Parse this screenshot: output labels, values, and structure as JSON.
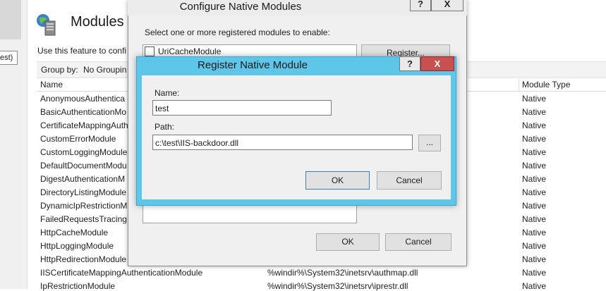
{
  "left_strip": {
    "selected_text": "est)"
  },
  "page": {
    "title": "Modules",
    "description": "Use this feature to confi",
    "group_by_label": "Group by:",
    "group_by_value": "No Groupin",
    "columns": {
      "name": "Name",
      "module_type": "Module Type"
    },
    "rows": [
      {
        "name": "AnonymousAuthentica",
        "code": "",
        "type": "Native"
      },
      {
        "name": "BasicAuthenticationMo",
        "code": "",
        "type": "Native"
      },
      {
        "name": "CertificateMappingAuth",
        "code": "",
        "type": "Native"
      },
      {
        "name": "CustomErrorModule",
        "code": "",
        "type": "Native"
      },
      {
        "name": "CustomLoggingModule",
        "code": "",
        "type": "Native"
      },
      {
        "name": "DefaultDocumentModu",
        "code": "",
        "type": "Native"
      },
      {
        "name": "DigestAuthenticationM",
        "code": "",
        "type": "Native"
      },
      {
        "name": "DirectoryListingModule",
        "code": "",
        "type": "Native"
      },
      {
        "name": "DynamicIpRestrictionM",
        "code": "",
        "type": "Native"
      },
      {
        "name": "FailedRequestsTracingM",
        "code": "",
        "type": "Native"
      },
      {
        "name": "HttpCacheModule",
        "code": "",
        "type": "Native"
      },
      {
        "name": "HttpLoggingModule",
        "code": "",
        "type": "Native"
      },
      {
        "name": "HttpRedirectionModule",
        "code": "",
        "type": "Native"
      },
      {
        "name": "IISCertificateMappingAuthenticationModule",
        "code": "%windir%\\System32\\inetsrv\\authmap.dll",
        "type": "Native"
      },
      {
        "name": "IpRestrictionModule",
        "code": "%windir%\\System32\\inetsrv\\iprestr.dll",
        "type": "Native"
      }
    ]
  },
  "configure_dialog": {
    "title": "Configure Native Modules",
    "help_glyph": "?",
    "close_glyph": "X",
    "instruction": "Select one or more registered modules to enable:",
    "list_items": [
      {
        "label": "UriCacheModule",
        "checked": false
      }
    ],
    "register_label": "Register...",
    "ok_label": "OK",
    "cancel_label": "Cancel"
  },
  "register_dialog": {
    "title": "Register Native Module",
    "help_glyph": "?",
    "close_glyph": "X",
    "name_label": "Name:",
    "name_value": "test",
    "path_label": "Path:",
    "path_value": "c:\\test\\IIS-backdoor.dll",
    "browse_label": "...",
    "ok_label": "OK",
    "cancel_label": "Cancel"
  },
  "colors": {
    "register_titlebar": "#5ec6e9",
    "close_button": "#c75050",
    "dialog_body": "#f0f0f0"
  }
}
